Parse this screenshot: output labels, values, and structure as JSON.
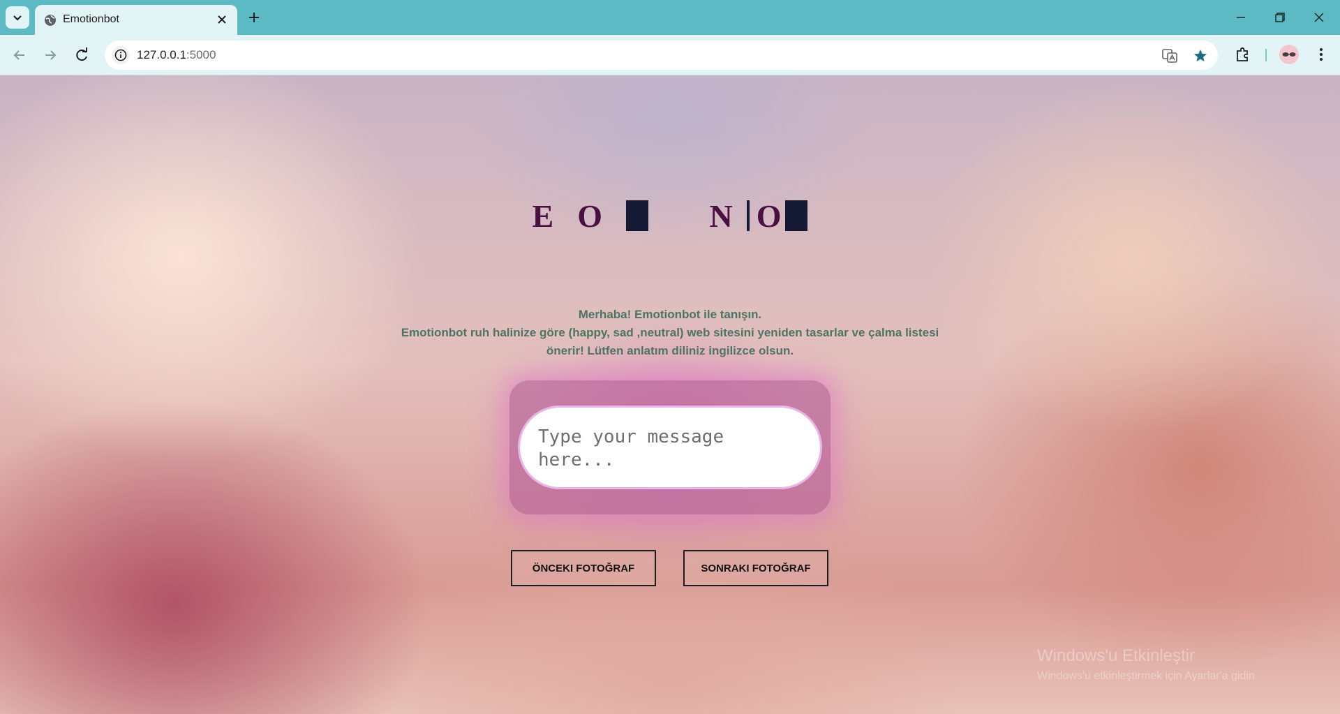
{
  "browser": {
    "tab_title": "Emotionbot",
    "url_host": "127.0.0.1",
    "url_port": ":5000"
  },
  "page": {
    "logo": {
      "part1": "E",
      "part2": "O",
      "part3": "N",
      "part4": "O"
    },
    "intro": {
      "line1": "Merhaba! Emotionbot ile tanışın.",
      "line2": "Emotionbot ruh halinize göre (happy, sad ,neutral) web sitesini yeniden tasarlar ve çalma listesi önerir! Lütfen anlatım diliniz ingilizce olsun."
    },
    "chat": {
      "placeholder": "Type your message here..."
    },
    "buttons": {
      "prev": "ÖNCEKI FOTOĞRAF",
      "next": "SONRAKI FOTOĞRAF"
    },
    "watermark": {
      "title": "Windows'u Etkinleştir",
      "subtitle": "Windows'u etkinleştirmek için Ayarlar'a gidin."
    }
  },
  "icons": {
    "tab_search": "chevron-down-icon",
    "favicon": "globe-icon",
    "tab_close": "close-icon",
    "new_tab": "plus-icon",
    "back": "arrow-left-icon",
    "forward": "arrow-right-icon",
    "reload": "reload-icon",
    "site_info": "info-icon",
    "translate": "translate-icon",
    "bookmark": "star-icon",
    "extensions": "puzzle-icon",
    "menu": "kebab-menu-icon"
  },
  "colors": {
    "tab_bar": "#5bbac4",
    "toolbar": "#e3f4f6",
    "logo": "#4a0f43",
    "intro_text": "#4c7565",
    "chat_frame": "#af5096"
  }
}
